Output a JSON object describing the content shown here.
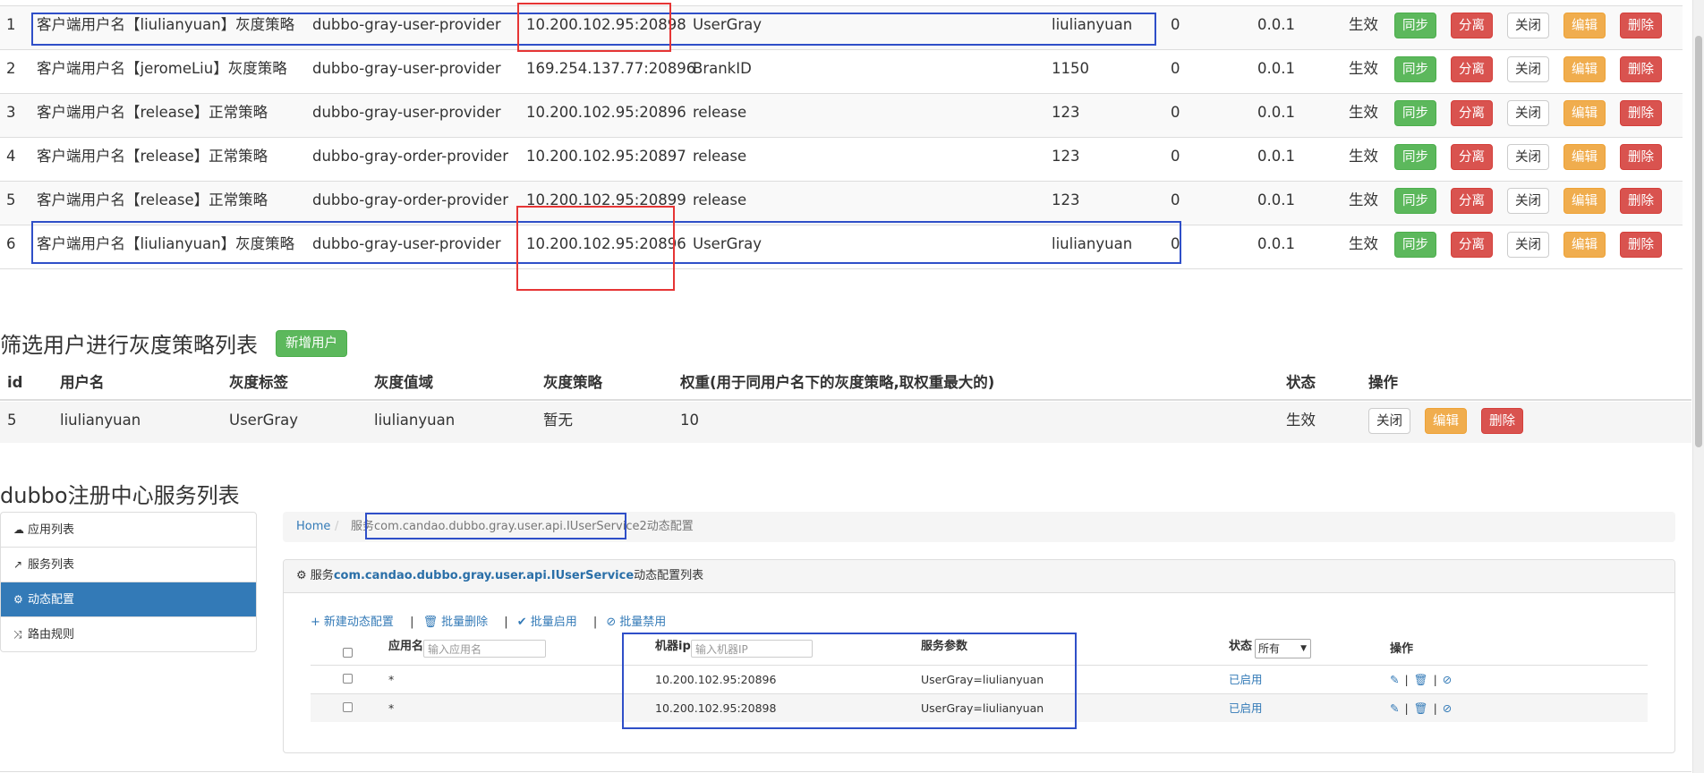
{
  "strategy_rows": [
    {
      "no": "1",
      "name": "客户端用户名【liulianyuan】灰度策略",
      "service": "dubbo-gray-user-provider",
      "ip": "10.200.102.95:20898",
      "tag": "UserGray",
      "value": "liulianyuan",
      "c7": "0",
      "weight": "0.0.1",
      "status": "生效"
    },
    {
      "no": "2",
      "name": "客户端用户名【jeromeLiu】灰度策略",
      "service": "dubbo-gray-user-provider",
      "ip": "169.254.137.77:20896",
      "tag": "BrankID",
      "value": "1150",
      "c7": "0",
      "weight": "0.0.1",
      "status": "生效"
    },
    {
      "no": "3",
      "name": "客户端用户名【release】正常策略",
      "service": "dubbo-gray-user-provider",
      "ip": "10.200.102.95:20896",
      "tag": "release",
      "value": "123",
      "c7": "0",
      "weight": "0.0.1",
      "status": "生效"
    },
    {
      "no": "4",
      "name": "客户端用户名【release】正常策略",
      "service": "dubbo-gray-order-provider",
      "ip": "10.200.102.95:20897",
      "tag": "release",
      "value": "123",
      "c7": "0",
      "weight": "0.0.1",
      "status": "生效"
    },
    {
      "no": "5",
      "name": "客户端用户名【release】正常策略",
      "service": "dubbo-gray-order-provider",
      "ip": "10.200.102.95:20899",
      "tag": "release",
      "value": "123",
      "c7": "0",
      "weight": "0.0.1",
      "status": "生效"
    },
    {
      "no": "6",
      "name": "客户端用户名【liulianyuan】灰度策略",
      "service": "dubbo-gray-user-provider",
      "ip": "10.200.102.95:20896",
      "tag": "UserGray",
      "value": "liulianyuan",
      "c7": "0",
      "weight": "0.0.1",
      "status": "生效"
    }
  ],
  "row_buttons": {
    "sync": "同步",
    "split": "分离",
    "close": "关闭",
    "edit": "编辑",
    "delete": "删除"
  },
  "filter": {
    "title": "筛选用户进行灰度策略列表",
    "add_button": "新增用户",
    "headers": {
      "id": "id",
      "username": "用户名",
      "tag": "灰度标签",
      "value": "灰度值域",
      "strategy": "灰度策略",
      "weight": "权重(用于同用户名下的灰度策略,取权重最大的)",
      "status": "状态",
      "ops": "操作"
    },
    "row": {
      "id": "5",
      "username": "liulianyuan",
      "tag": "UserGray",
      "value": "liulianyuan",
      "strategy": "暂无",
      "weight": "10",
      "status": "生效"
    },
    "buttons": {
      "close": "关闭",
      "edit": "编辑",
      "delete": "删除"
    }
  },
  "registry": {
    "title": "dubbo注册中心服务列表",
    "sidebar": [
      {
        "label": "应用列表",
        "icon": "cloud-icon",
        "glyph": "☁"
      },
      {
        "label": "服务列表",
        "icon": "share-icon",
        "glyph": "↗"
      },
      {
        "label": "动态配置",
        "icon": "cogs-icon",
        "glyph": "⚙"
      },
      {
        "label": "路由规则",
        "icon": "random-icon",
        "glyph": "⤨"
      }
    ],
    "breadcrumb": {
      "home": "Home",
      "sep": "/",
      "current": "服务com.candao.dubbo.gray.user.api.IUserService2动态配置"
    },
    "panel": {
      "title_prefix": "服务",
      "service": "com.candao.dubbo.gray.user.api.IUserService",
      "title_suffix": "动态配置列表",
      "toolbar": {
        "add": "新建动态配置",
        "batch_delete": "批量删除",
        "batch_enable": "批量启用",
        "batch_disable": "批量禁用",
        "sep": "|"
      },
      "headers": {
        "app": "应用名",
        "app_placeholder": "输入应用名",
        "ip": "机器ip",
        "ip_placeholder": "输入机器IP",
        "params": "服务参数",
        "status": "状态",
        "status_select": "所有",
        "ops": "操作"
      },
      "rows": [
        {
          "app": "*",
          "ip": "10.200.102.95:20896",
          "params": "UserGray=liulianyuan",
          "status": "已启用"
        },
        {
          "app": "*",
          "ip": "10.200.102.95:20898",
          "params": "UserGray=liulianyuan",
          "status": "已启用"
        }
      ],
      "op_sep": "|"
    }
  },
  "colors": {
    "success": "#5cb85c",
    "danger": "#d9534f",
    "warning": "#f0ad4e",
    "primary": "#337ab7",
    "annotation_blue": "#2f4fc8",
    "annotation_red": "#e63535"
  }
}
